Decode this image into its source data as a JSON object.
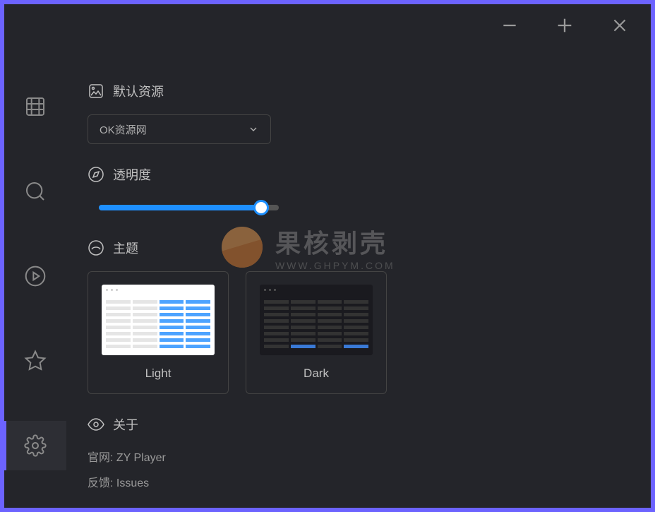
{
  "settings": {
    "default_source": {
      "title": "默认资源",
      "selected": "OK资源网"
    },
    "opacity": {
      "title": "透明度"
    },
    "theme": {
      "title": "主题",
      "options": [
        "Light",
        "Dark"
      ]
    },
    "about": {
      "title": "关于",
      "website_label": "官网:",
      "website_value": "ZY Player",
      "feedback_label": "反馈:",
      "feedback_value": "Issues"
    }
  },
  "watermark": {
    "main": "果核剥壳",
    "sub": "WWW.GHPYM.COM"
  }
}
